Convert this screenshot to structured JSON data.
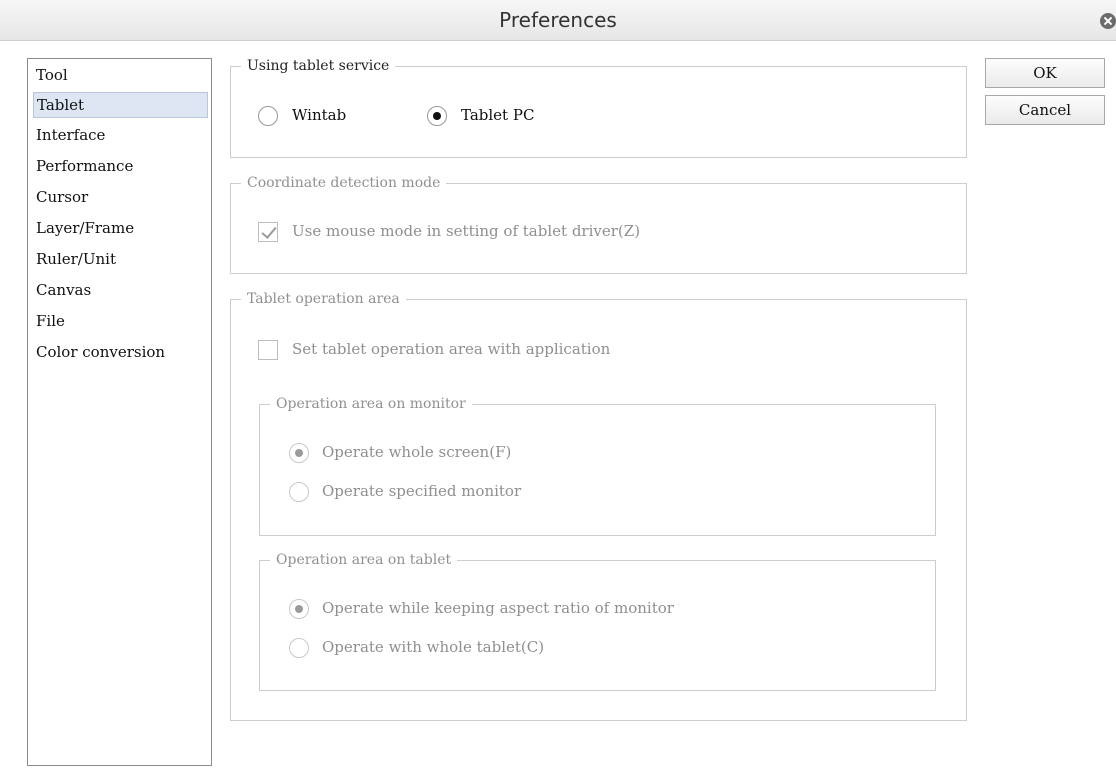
{
  "window": {
    "title": "Preferences"
  },
  "categories": [
    "Tool",
    "Tablet",
    "Interface",
    "Performance",
    "Cursor",
    "Layer/Frame",
    "Ruler/Unit",
    "Canvas",
    "File",
    "Color conversion"
  ],
  "selected_category": "Tablet",
  "buttons": {
    "ok": "OK",
    "cancel": "Cancel"
  },
  "tablet_service": {
    "legend": "Using tablet service",
    "options": [
      "Wintab",
      "Tablet PC"
    ],
    "selected": "Tablet PC"
  },
  "coordinate_detection": {
    "legend": "Coordinate detection mode",
    "checkbox_label": "Use mouse mode in setting of tablet driver(Z)",
    "checked": true,
    "enabled": false
  },
  "operation_area": {
    "legend": "Tablet operation area",
    "checkbox_label": "Set tablet operation area with application",
    "checked": false,
    "enabled": false,
    "monitor_group": {
      "legend": "Operation area on monitor",
      "options": [
        "Operate whole screen(F)",
        "Operate specified monitor"
      ],
      "selected": "Operate whole screen(F)"
    },
    "tablet_group": {
      "legend": "Operation area on tablet",
      "options": [
        "Operate while keeping aspect ratio of monitor",
        "Operate with whole tablet(C)"
      ],
      "selected": "Operate while keeping aspect ratio of monitor"
    }
  }
}
